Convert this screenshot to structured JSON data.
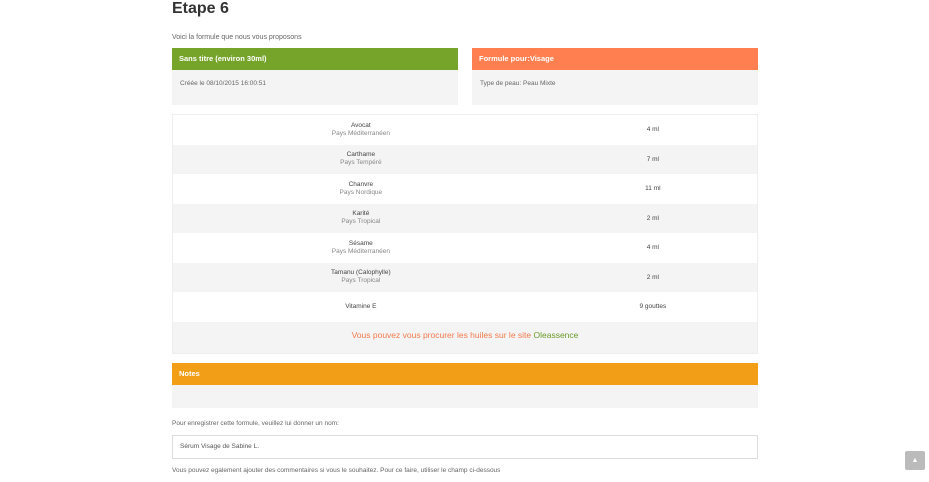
{
  "page": {
    "title": "Etape 6",
    "intro": "Voici la formule que nous vous proposons"
  },
  "colors": {
    "green": "#76a32a",
    "coral": "#ff7f50",
    "orange": "#f29e17"
  },
  "formula_card": {
    "title": "Sans titre (environ 30ml)",
    "created": "Créée le 08/10/2015 16:00:51"
  },
  "skin_card": {
    "title": "Formule pour:Visage",
    "skin_type": "Type de peau: Peau Mixte"
  },
  "ingredients": [
    {
      "name": "Avocat",
      "origin": "Pays Méditerranéen",
      "qty": "4 ml"
    },
    {
      "name": "Carthame",
      "origin": "Pays Tempéré",
      "qty": "7 ml"
    },
    {
      "name": "Chanvre",
      "origin": "Pays Nordique",
      "qty": "11 ml"
    },
    {
      "name": "Karité",
      "origin": "Pays Tropical",
      "qty": "2 ml"
    },
    {
      "name": "Sésame",
      "origin": "Pays Méditerranéen",
      "qty": "4 ml"
    },
    {
      "name": "Tamanu (Calophylle)",
      "origin": "Pays Tropical",
      "qty": "2 ml"
    },
    {
      "name": "Vitamine E",
      "origin": "",
      "qty": "9 gouttes"
    }
  ],
  "supplier": {
    "text": "Vous pouvez vous procurer les huiles sur le site ",
    "link": "Oleassence"
  },
  "notes": {
    "title": "Notes"
  },
  "save": {
    "label": "Pour enregistrer cette formule, veuillez lui donner un nom:",
    "name_value": "Sérum Visage de Sabine L.",
    "comment_label": "Vous pouvez egalement ajouter des commentaires si vous le souhaitez. Pour ce faire, utiliser le champ ci-dessous"
  },
  "scroll_top_icon": "chevron-up-icon"
}
